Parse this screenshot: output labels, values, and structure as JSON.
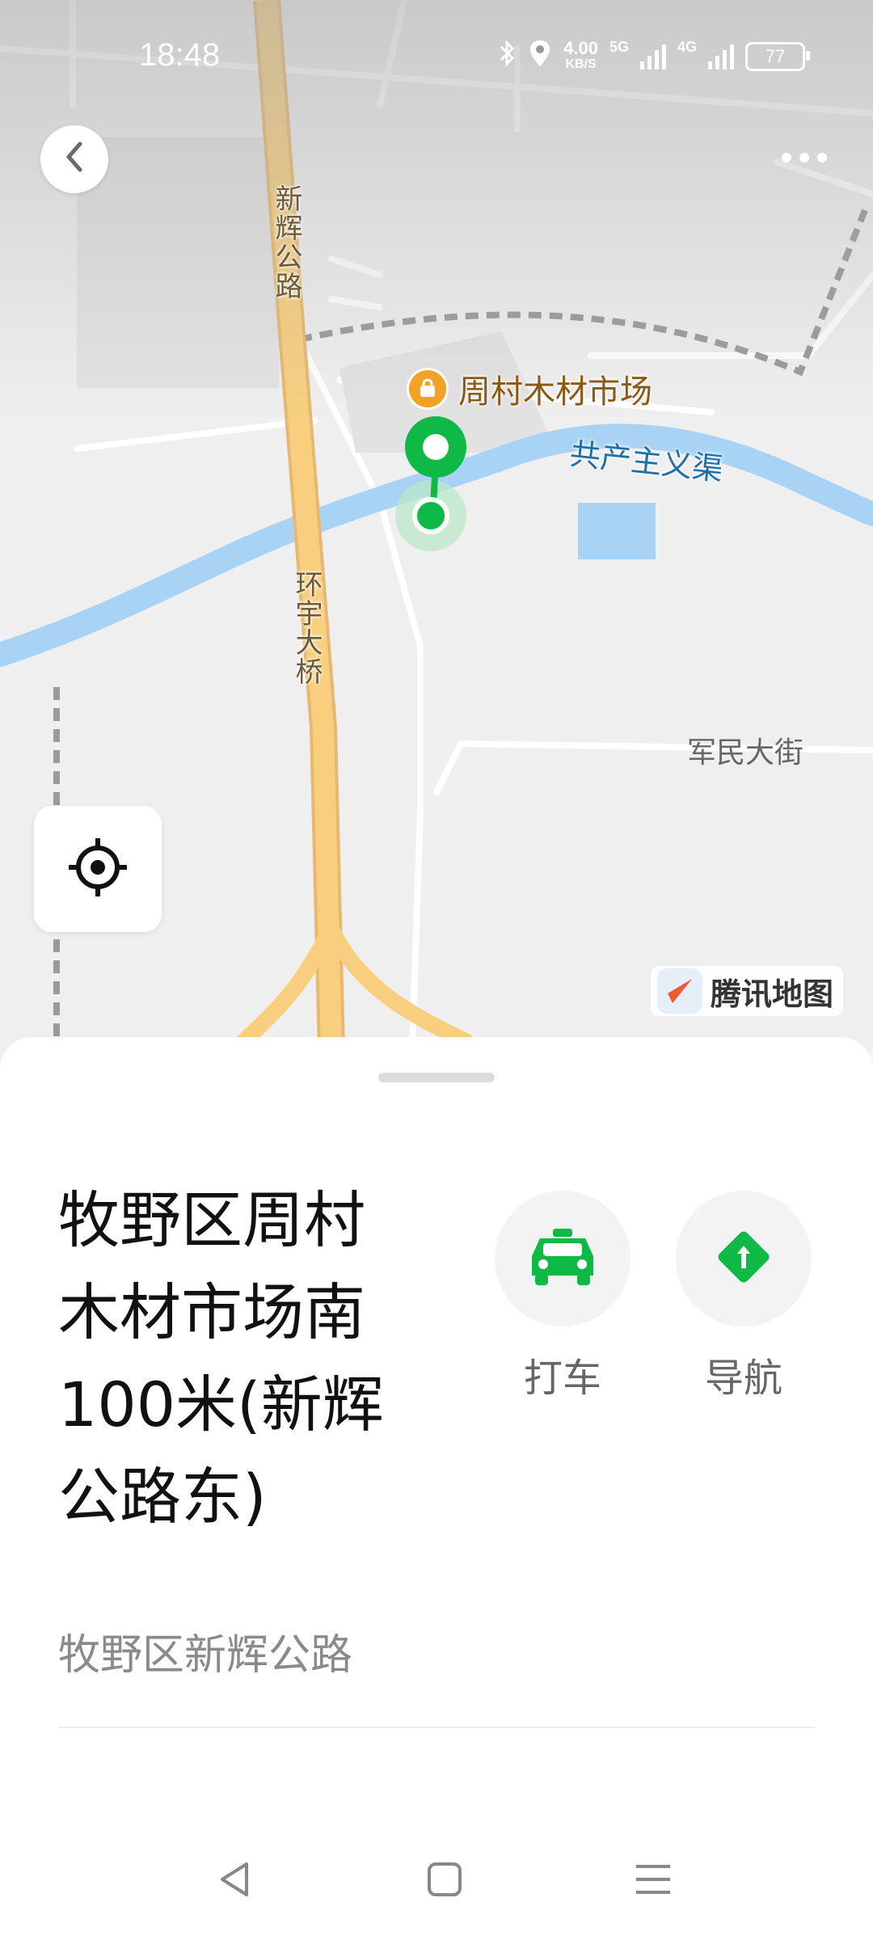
{
  "status_bar": {
    "time": "18:48",
    "net_speed_value": "4.00",
    "net_speed_unit": "KB/S",
    "sig1_label": "5G",
    "sig2_label": "4G",
    "battery": "77",
    "icons": [
      "bluetooth-icon",
      "location-icon"
    ]
  },
  "map": {
    "road_xinhui": "新辉公路",
    "bridge_huanyu": "环宇大桥",
    "poi_name": "周村木材市场",
    "river_name": "共产主义渠",
    "street_junmin": "军民大街",
    "brand_name": "腾讯地图",
    "colors": {
      "river": "#a9d3f5",
      "highway": "#f7cf7f",
      "marker": "#0fb945",
      "poi": "#f3a227"
    }
  },
  "sheet": {
    "title": "牧野区周村木材市场南100米(新辉公路东)",
    "actions": [
      {
        "label": "打车",
        "icon": "taxi-icon"
      },
      {
        "label": "导航",
        "icon": "navigation-icon"
      }
    ],
    "address": "牧野区新辉公路"
  },
  "nav_bar": {
    "buttons": [
      "back-icon",
      "home-icon",
      "menu-icon"
    ]
  }
}
